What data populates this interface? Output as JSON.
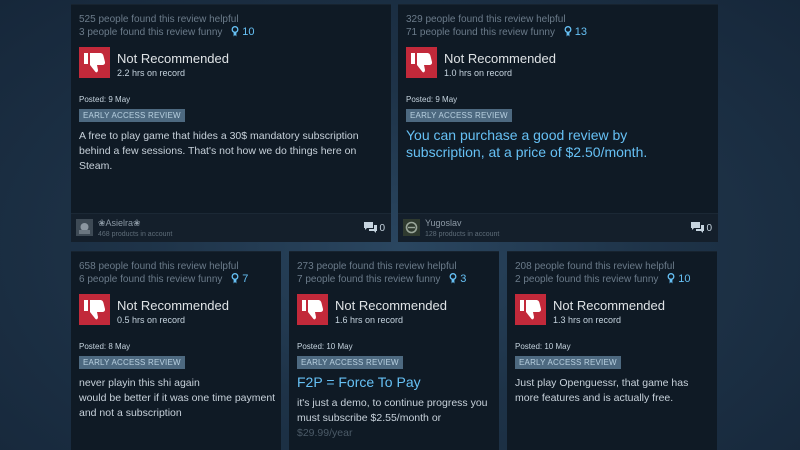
{
  "reviews": [
    {
      "helpful": "525 people found this review helpful",
      "funny": "3 people found this review funny",
      "awards": "10",
      "title": "Not Recommended",
      "hours": "2.2 hrs on record",
      "posted": "Posted: 9 May",
      "badge": "EARLY ACCESS REVIEW",
      "text": "A free to play game that hides a 30$ mandatory subscription behind a few sessions. That's not how we do things here on Steam.",
      "user": "❀Asielra❀",
      "products": "468 products in account",
      "comments": "0"
    },
    {
      "helpful": "329 people found this review helpful",
      "funny": "71 people found this review funny",
      "awards": "13",
      "title": "Not Recommended",
      "hours": "1.0 hrs on record",
      "posted": "Posted: 9 May",
      "badge": "EARLY ACCESS REVIEW",
      "text": "You can purchase a good review by subscription, at a price of $2.50/month.",
      "user": "Yugoslav",
      "products": "128 products in account",
      "comments": "0"
    },
    {
      "helpful": "658 people found this review helpful",
      "funny": "6 people found this review funny",
      "awards": "7",
      "title": "Not Recommended",
      "hours": "0.5 hrs on record",
      "posted": "Posted: 8 May",
      "badge": "EARLY ACCESS REVIEW",
      "text_lines": [
        "never playin this shi again",
        "would be better if it was one time payment",
        "and not a subscription"
      ]
    },
    {
      "helpful": "273 people found this review helpful",
      "funny": "7 people found this review funny",
      "awards": "3",
      "title": "Not Recommended",
      "hours": "1.6 hrs on record",
      "posted": "Posted: 10 May",
      "badge": "EARLY ACCESS REVIEW",
      "heading": "F2P = Force To Pay",
      "text": "it's just a demo, to continue progress you must subscribe $2.55/month or",
      "text_faded": "$29.99/year"
    },
    {
      "helpful": "208 people found this review helpful",
      "funny": "2 people found this review funny",
      "awards": "10",
      "title": "Not Recommended",
      "hours": "1.3 hrs on record",
      "posted": "Posted: 10 May",
      "badge": "EARLY ACCESS REVIEW",
      "text": "Just play Openguessr, that game has more features and is actually free."
    }
  ],
  "icons": {
    "thumb": "thumbs-down-icon",
    "award": "award-icon",
    "comment": "comment-icon",
    "avatar": "avatar"
  },
  "colors": {
    "background": "#1b2838",
    "card": "#0f1a25",
    "not_recommended": "#c2293a",
    "accent": "#66c0f4",
    "badge": "#4d6980"
  }
}
